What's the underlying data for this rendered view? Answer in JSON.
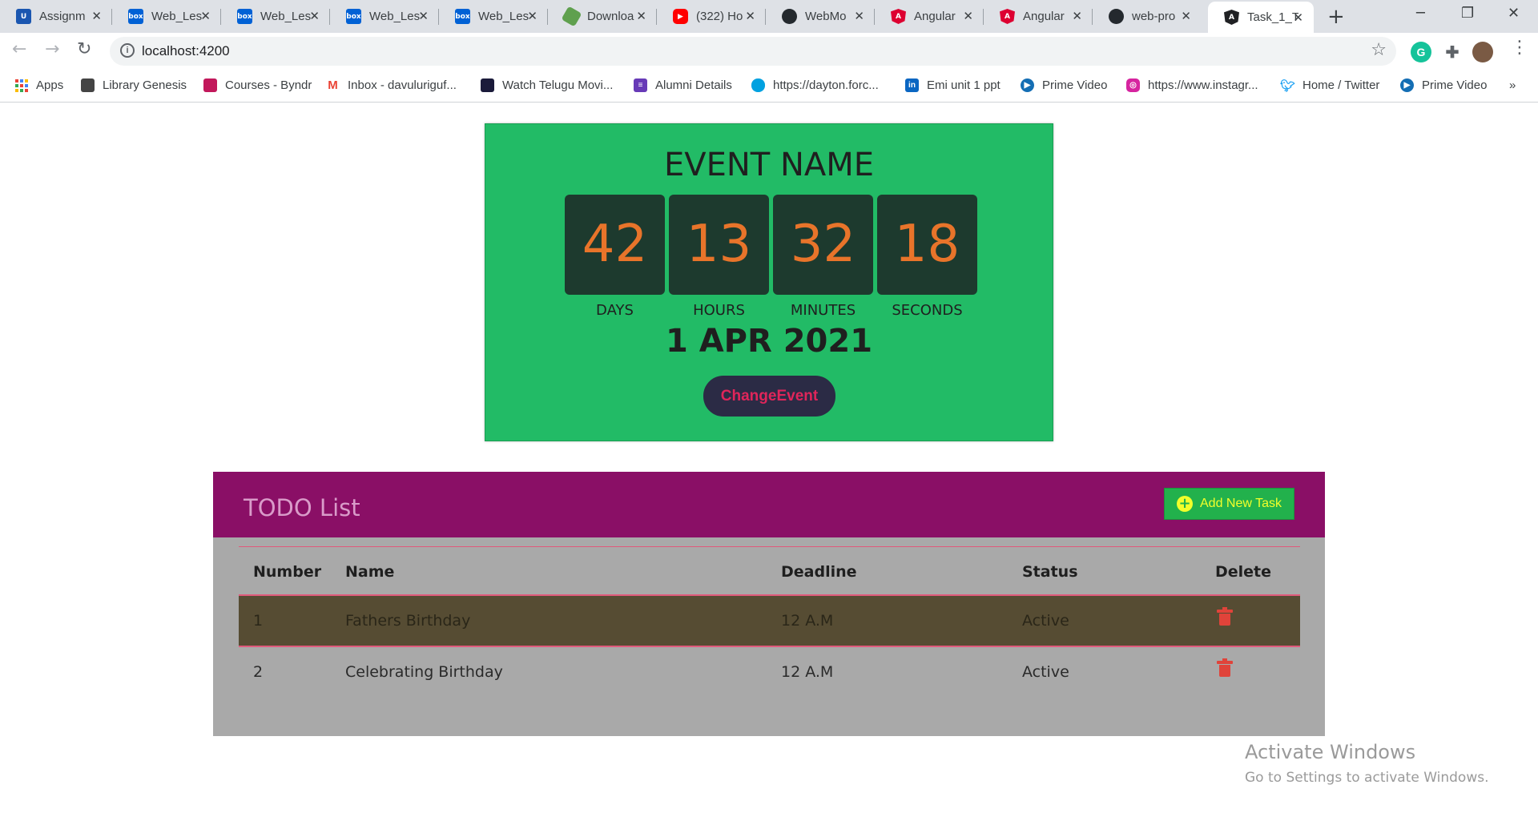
{
  "browser": {
    "tabs": [
      {
        "title": "Assignm",
        "icon": "umkc-icon",
        "color": "#1a56b0"
      },
      {
        "title": "Web_Les",
        "icon": "box-icon",
        "color": "#0061d5"
      },
      {
        "title": "Web_Les",
        "icon": "box-icon",
        "color": "#0061d5"
      },
      {
        "title": "Web_Les",
        "icon": "box-icon",
        "color": "#0061d5"
      },
      {
        "title": "Web_Les",
        "icon": "box-icon",
        "color": "#0061d5"
      },
      {
        "title": "Downloa",
        "icon": "node-icon",
        "color": "#5fa04e"
      },
      {
        "title": "(322) Ho",
        "icon": "youtube-icon",
        "color": "#ff0000"
      },
      {
        "title": "WebMo",
        "icon": "github-icon",
        "color": "#24292e"
      },
      {
        "title": "Angular",
        "icon": "angular-icon",
        "color": "#dd0031"
      },
      {
        "title": "Angular",
        "icon": "angular-icon",
        "color": "#dd0031"
      },
      {
        "title": "web-pro",
        "icon": "github-icon",
        "color": "#24292e"
      },
      {
        "title": "Task_1_T",
        "icon": "angular-icon",
        "color": "#202124",
        "active": true
      }
    ],
    "url": "localhost:4200",
    "bookmarks": [
      {
        "label": "Apps",
        "icon": "apps-grid-icon"
      },
      {
        "label": "Library Genesis",
        "icon": "libgen-icon",
        "color": "#444444"
      },
      {
        "label": "Courses - Byndr",
        "icon": "byndr-icon",
        "color": "#c2185b"
      },
      {
        "label": "Inbox - davuluriguf...",
        "icon": "gmail-icon",
        "color": "#ea4335"
      },
      {
        "label": "Watch Telugu Movi...",
        "icon": "movie-icon",
        "color": "#1a1a3a"
      },
      {
        "label": "Alumni Details",
        "icon": "forms-icon",
        "color": "#673ab7"
      },
      {
        "label": "https://dayton.forc...",
        "icon": "salesforce-icon",
        "color": "#00a1e0"
      },
      {
        "label": "Emi unit 1 ppt",
        "icon": "linkedin-icon",
        "color": "#0a66c2"
      },
      {
        "label": "Prime Video",
        "icon": "prime-video-icon",
        "color": "#146eb4"
      },
      {
        "label": "https://www.instagr...",
        "icon": "instagram-icon",
        "color": "#d6249f"
      },
      {
        "label": "Home / Twitter",
        "icon": "twitter-icon",
        "color": "#1da1f2"
      },
      {
        "label": "Prime Video",
        "icon": "prime-video-icon",
        "color": "#146eb4"
      }
    ],
    "overflow": "»"
  },
  "event": {
    "name": "EVENT NAME",
    "countdown": [
      {
        "value": "42",
        "label": "DAYS"
      },
      {
        "value": "13",
        "label": "HOURS"
      },
      {
        "value": "32",
        "label": "MINUTES"
      },
      {
        "value": "18",
        "label": "SECONDS"
      }
    ],
    "date": "1 APR 2021",
    "change_button": "ChangeEvent",
    "colors": {
      "card": "#22bb66",
      "digit_box": "#1d3a2e",
      "digit": "#e8742a",
      "button": "#2b2b45",
      "button_text": "#e0255a"
    }
  },
  "todo": {
    "title": "TODO List",
    "add_button": "Add New Task",
    "columns": [
      "Number",
      "Name",
      "Deadline",
      "Status",
      "Delete"
    ],
    "rows": [
      {
        "number": "1",
        "name": "Fathers Birthday",
        "deadline": "12 A.M",
        "status": "Active",
        "delete_icon": "trash-icon",
        "highlighted": true
      },
      {
        "number": "2",
        "name": "Celebrating Birthday",
        "deadline": "12 A.M",
        "status": "Active",
        "delete_icon": "trash-icon",
        "highlighted": false
      }
    ],
    "colors": {
      "header": "#8a0f66",
      "panel": "#a9a9a9",
      "highlight_row": "#564c33",
      "add_button": "#22b14c",
      "add_text": "#f2ff2a"
    }
  },
  "watermark": {
    "line1": "Activate Windows",
    "line2": "Go to Settings to activate Windows."
  }
}
